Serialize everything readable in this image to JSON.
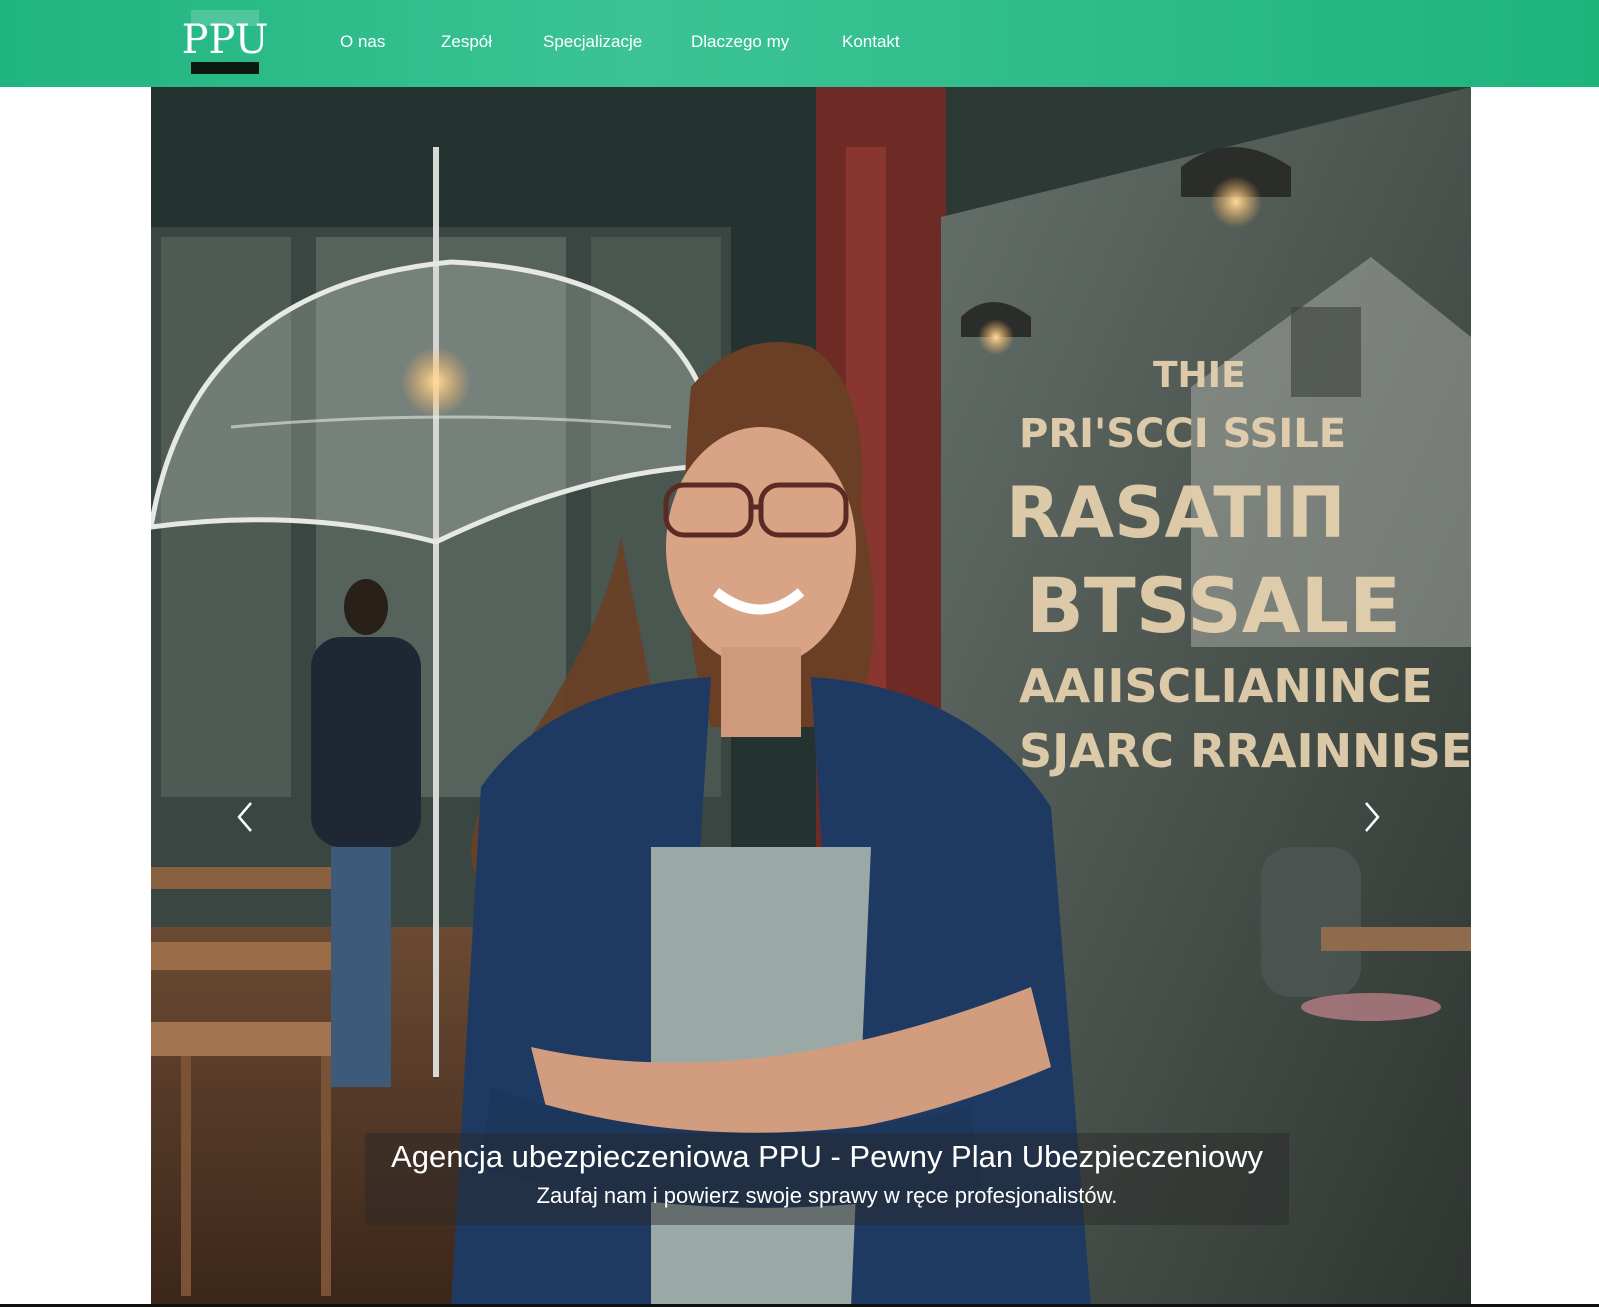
{
  "brand": {
    "logo_text": "PPU",
    "color_primary": "#1fb57f"
  },
  "nav": {
    "items": [
      {
        "label": "O nas"
      },
      {
        "label": "Zespół"
      },
      {
        "label": "Specjalizacje"
      },
      {
        "label": "Dlaczego my"
      },
      {
        "label": "Kontakt"
      }
    ]
  },
  "carousel": {
    "prev_icon": "chevron-left-icon",
    "next_icon": "chevron-right-icon",
    "slide": {
      "image_window_text": [
        "THIE",
        "PRI'SCCI SSILE",
        "RASATIΠ",
        "BTSSALE",
        "AAIISCLIANINCE",
        "SJARC RRAINNISE"
      ],
      "caption_title": "Agencja ubezpieczeniowa PPU - Pewny Plan Ubezpieczeniowy",
      "caption_text": "Zaufaj nam i powierz swoje sprawy w ręce profesjonalistów."
    }
  }
}
